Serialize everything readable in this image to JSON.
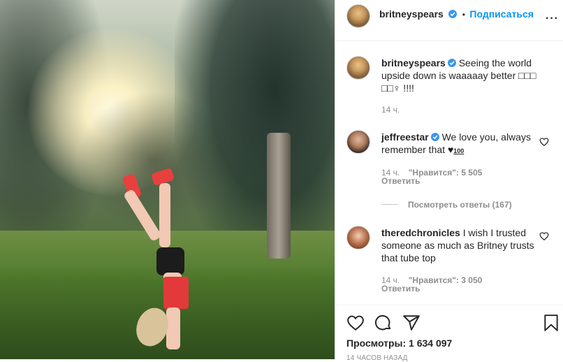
{
  "post": {
    "author": "britneyspears",
    "follow_label": "Подписаться",
    "dot": "•",
    "caption": "Seeing the world upside down is waaaaay better",
    "caption_emoji_line1": "□□□",
    "caption_emoji_line2": "□□♀ !!!!",
    "caption_time": "14 ч."
  },
  "comments": [
    {
      "author": "jeffreestar",
      "text": "We love you, always remember that",
      "emoji": "♥",
      "emoji_100": "100",
      "time": "14 ч.",
      "likes": "\"Нравится\": 5 505",
      "reply_label": "Ответить",
      "view_replies": "Посмотреть ответы (167)"
    },
    {
      "author": "theredchronicles",
      "text": "I wish I trusted someone as much as Britney trusts that tube top",
      "time": "14 ч.",
      "likes": "\"Нравится\": 3 050",
      "reply_label": "Ответить"
    }
  ],
  "footer": {
    "views": "Просмотры: 1 634 097",
    "posted_ago": "14 ЧАСОВ НАЗАД"
  },
  "icons": [
    "verified-badge-icon",
    "heart-icon",
    "comment-icon",
    "share-icon",
    "bookmark-icon"
  ],
  "colors": {
    "link_blue": "#0095f6",
    "verified_blue": "#3897f0",
    "muted": "#8e8e8e"
  }
}
